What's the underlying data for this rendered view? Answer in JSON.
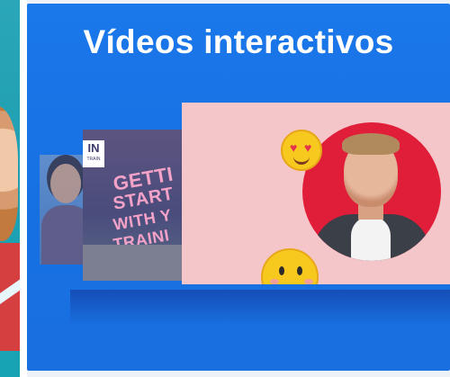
{
  "card": {
    "title": "Vídeos interactivos"
  },
  "thumbnails": {
    "middle": {
      "logo": "IN",
      "logo_sub": "TRAIN",
      "lines": [
        "GETTI",
        "START",
        "WITH Y",
        "TRAINI"
      ]
    },
    "front": {
      "emojis": [
        "heart-eyes-emoji",
        "smiling-face-emoji"
      ]
    }
  },
  "colors": {
    "card_blue": "#1b78ea",
    "red_circle": "#e11e3a",
    "pink_background": "#f5c6c9",
    "emoji_yellow": "#f7c81e",
    "left_slide_teal": "#2aa6b8"
  }
}
